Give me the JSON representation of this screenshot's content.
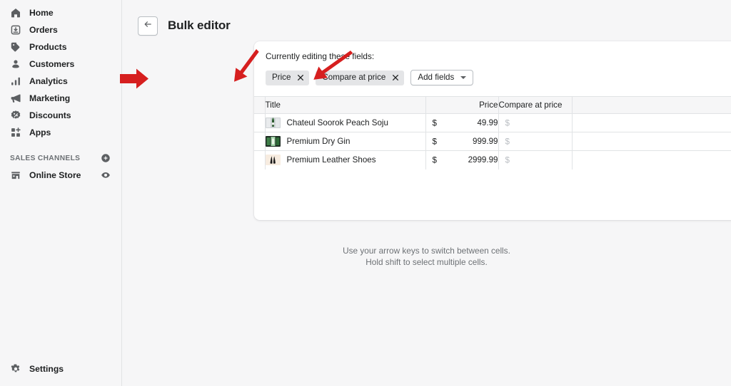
{
  "sidebar": {
    "items": [
      {
        "label": "Home",
        "icon": "home-icon"
      },
      {
        "label": "Orders",
        "icon": "orders-icon"
      },
      {
        "label": "Products",
        "icon": "products-tag-icon"
      },
      {
        "label": "Customers",
        "icon": "customers-person-icon"
      },
      {
        "label": "Analytics",
        "icon": "analytics-bars-icon"
      },
      {
        "label": "Marketing",
        "icon": "marketing-megaphone-icon"
      },
      {
        "label": "Discounts",
        "icon": "discounts-icon"
      },
      {
        "label": "Apps",
        "icon": "apps-icon"
      }
    ],
    "section": {
      "title": "SALES CHANNELS",
      "action_icon": "plus-circle-icon"
    },
    "channels": [
      {
        "label": "Online Store",
        "icon": "online-store-icon",
        "action_icon": "eye-icon"
      }
    ],
    "settings": {
      "label": "Settings",
      "icon": "gear-icon"
    }
  },
  "header": {
    "back_icon": "arrow-left-icon",
    "title": "Bulk editor"
  },
  "editor": {
    "editing_label": "Currently editing these fields:",
    "chips": [
      {
        "label": "Price",
        "remove_icon": "close-icon"
      },
      {
        "label": "Compare at price",
        "remove_icon": "close-icon"
      }
    ],
    "add_fields": {
      "label": "Add fields",
      "caret_icon": "caret-down-icon"
    }
  },
  "table": {
    "columns": [
      "Title",
      "Price",
      "Compare at price"
    ],
    "rows": [
      {
        "title": "Chateul Soorok Peach Soju",
        "price_symbol": "$",
        "price": "49.99",
        "compare_symbol": "$",
        "compare": "",
        "thumb": "soju-bottle-thumb"
      },
      {
        "title": "Premium Dry Gin",
        "price_symbol": "$",
        "price": "999.99",
        "compare_symbol": "$",
        "compare": "",
        "thumb": "gin-bottle-thumb"
      },
      {
        "title": "Premium Leather Shoes",
        "price_symbol": "$",
        "price": "2999.99",
        "compare_symbol": "$",
        "compare": "",
        "thumb": "leather-shoes-thumb"
      }
    ]
  },
  "hint": {
    "line1": "Use your arrow keys to switch between cells.",
    "line2": "Hold shift to select multiple cells."
  },
  "colors": {
    "page_bg": "#f6f6f7",
    "card_bg": "#ffffff",
    "text": "#202223",
    "muted": "#6d7175",
    "border": "#e1e3e5",
    "chip_bg": "#e4e5e7",
    "annotation_red": "#d61f1f"
  }
}
